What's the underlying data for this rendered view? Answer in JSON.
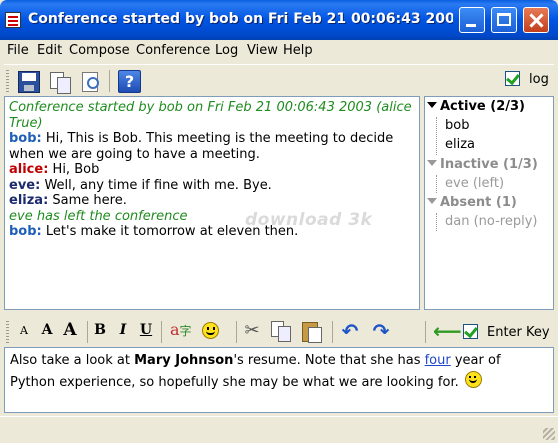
{
  "window": {
    "title": "Conference started by bob on Fri Feb 21 00:06:43 200..."
  },
  "menu": [
    "File",
    "Edit",
    "Compose",
    "Conference",
    "Log",
    "View",
    "Help"
  ],
  "toolbar": {
    "log_label": "log",
    "log_checked": true,
    "help_glyph": "?"
  },
  "transcript": [
    {
      "type": "system",
      "text": "Conference started by bob on Fri Feb 21 00:06:43 2003 (alice True)"
    },
    {
      "type": "msg",
      "nick": "bob:",
      "text": " Hi, This is Bob. This meeting is the meeting to decide when we are going to have a meeting."
    },
    {
      "type": "msg",
      "nick": "alice:",
      "text": " Hi, Bob"
    },
    {
      "type": "msg",
      "nick": "eve:",
      "text": " Well, any time if fine with me. Bye."
    },
    {
      "type": "msg",
      "nick": "eliza:",
      "text": " Same here."
    },
    {
      "type": "system",
      "text": "eve has left the conference"
    },
    {
      "type": "msg",
      "nick": "bob:",
      "text": " Let's make it tomorrow at eleven then."
    }
  ],
  "participants": {
    "active": {
      "label": "Active (2/3)",
      "members": [
        "bob",
        "eliza"
      ]
    },
    "inactive": {
      "label": "Inactive (1/3)",
      "members": [
        "eve (left)"
      ]
    },
    "absent": {
      "label": "Absent (1)",
      "members": [
        "dan (no-reply)"
      ]
    }
  },
  "format_toolbar": {
    "font_smaller": "A",
    "font_normal": "A",
    "font_larger": "A",
    "bold": "B",
    "italic": "I",
    "underline": "U",
    "spell": "a",
    "cut_glyph": "✂",
    "undo_glyph": "↶",
    "redo_glyph": "↷",
    "send_glyph": "⟵",
    "enter_key_label": "Enter Key",
    "enter_key_checked": true
  },
  "compose": {
    "part1": "Also take a look at ",
    "bold": "Mary Johnson",
    "part2": "'s resume. Note that she has ",
    "underlined": "four",
    "part3": " year of Python experience, so hopefully she may be what we are looking for. "
  },
  "watermark": "download 3k"
}
